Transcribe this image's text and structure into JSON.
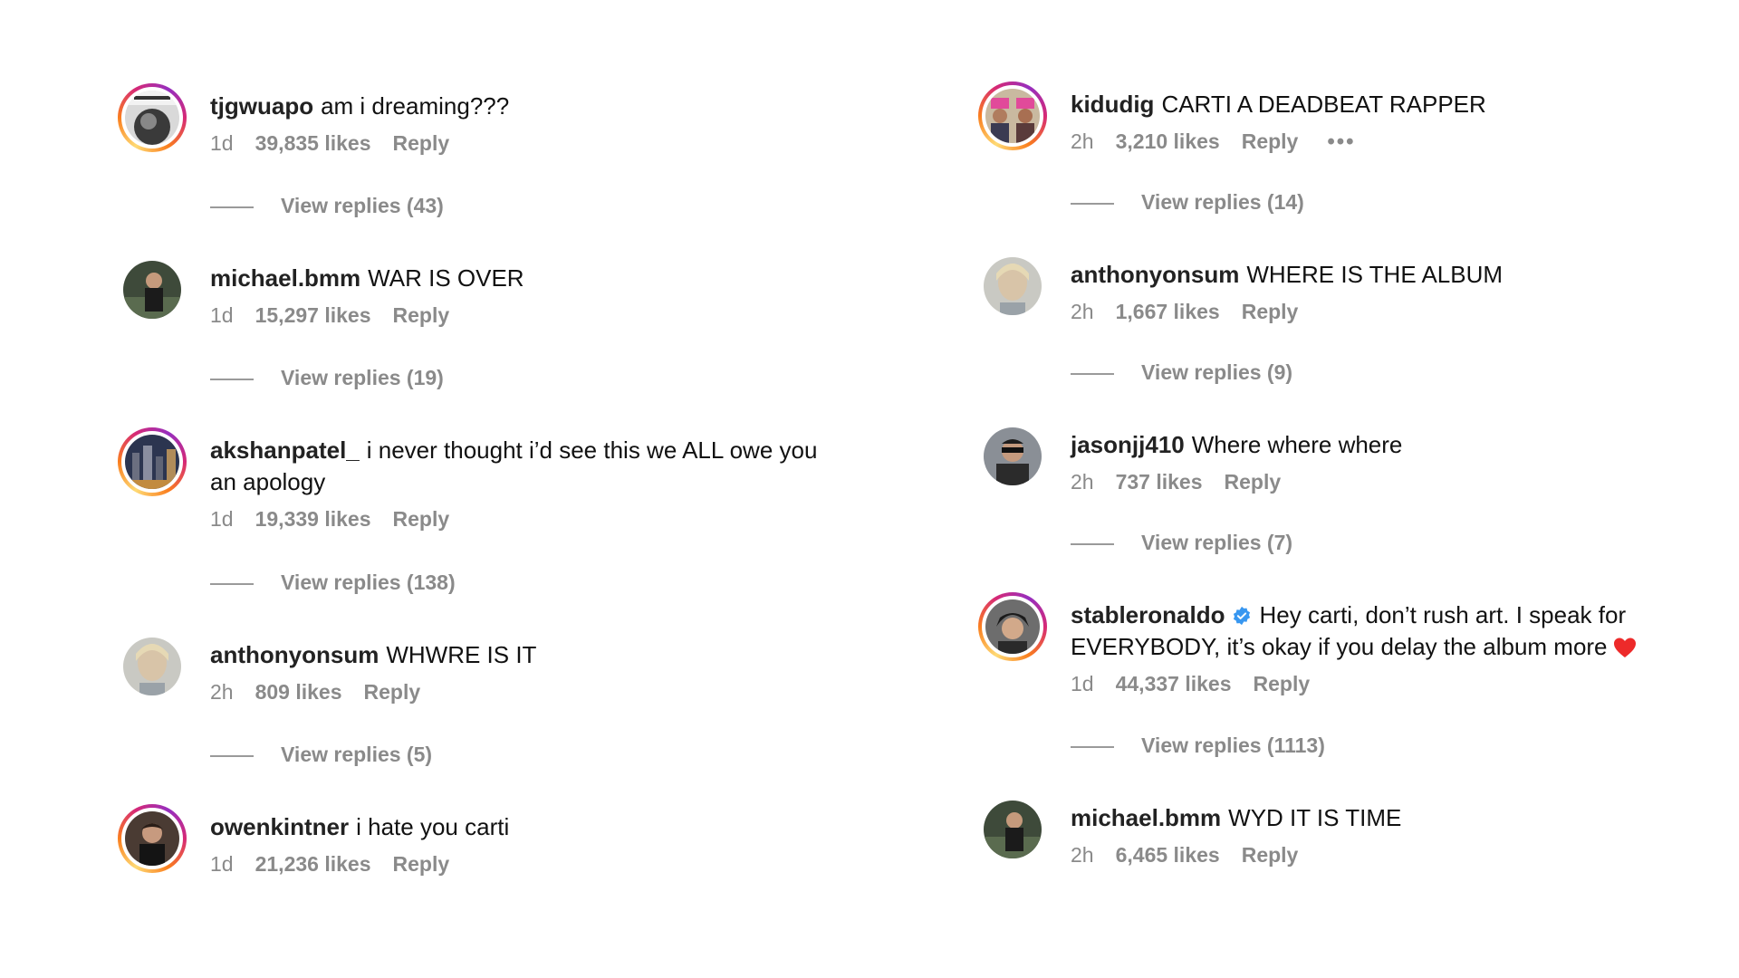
{
  "left_comments": [
    {
      "username": "tjgwuapo",
      "text": "am i dreaming???",
      "time": "1d",
      "likes": "39,835 likes",
      "reply": "Reply",
      "view_replies": "View replies (43)",
      "avatar_icon": "photo-avatar",
      "story_ring": true
    },
    {
      "username": "michael.bmm",
      "text": "WAR IS OVER",
      "time": "1d",
      "likes": "15,297 likes",
      "reply": "Reply",
      "view_replies": "View replies (19)",
      "avatar_icon": "photo-avatar",
      "story_ring": false
    },
    {
      "username": "akshanpatel_",
      "text": "i never thought i’d see this we ALL owe you an apology",
      "time": "1d",
      "likes": "19,339 likes",
      "reply": "Reply",
      "view_replies": "View replies (138)",
      "avatar_icon": "photo-avatar",
      "story_ring": true
    },
    {
      "username": "anthonyonsum",
      "text": "WHWRE IS IT",
      "time": "2h",
      "likes": "809 likes",
      "reply": "Reply",
      "view_replies": "View replies (5)",
      "avatar_icon": "photo-avatar",
      "story_ring": false
    },
    {
      "username": "owenkintner",
      "text": "i hate you carti",
      "time": "1d",
      "likes": "21,236 likes",
      "reply": "Reply",
      "view_replies": "",
      "avatar_icon": "photo-avatar",
      "story_ring": true
    }
  ],
  "right_comments": [
    {
      "username": "kidudig",
      "text": "CARTI A DEADBEAT RAPPER",
      "time": "2h",
      "likes": "3,210 likes",
      "reply": "Reply",
      "more": "•••",
      "view_replies": "View replies (14)",
      "avatar_icon": "photo-avatar",
      "story_ring": true
    },
    {
      "username": "anthonyonsum",
      "text": "WHERE IS THE ALBUM",
      "time": "2h",
      "likes": "1,667 likes",
      "reply": "Reply",
      "view_replies": "View replies (9)",
      "avatar_icon": "photo-avatar",
      "story_ring": false
    },
    {
      "username": "jasonjj410",
      "text": "Where where where",
      "time": "2h",
      "likes": "737 likes",
      "reply": "Reply",
      "view_replies": "View replies (7)",
      "avatar_icon": "photo-avatar",
      "story_ring": false
    },
    {
      "username": "stableronaldo",
      "verified": true,
      "text": "Hey carti, don’t rush art. I speak for EVERYBODY, it’s okay if you delay the album more",
      "heart": "red-heart-emoji",
      "time": "1d",
      "likes": "44,337 likes",
      "reply": "Reply",
      "view_replies": "View replies (1113)",
      "avatar_icon": "photo-avatar",
      "story_ring": true
    },
    {
      "username": "michael.bmm",
      "text": "WYD IT IS TIME",
      "time": "2h",
      "likes": "6,465 likes",
      "reply": "Reply",
      "view_replies": "",
      "avatar_icon": "photo-avatar",
      "story_ring": false
    }
  ],
  "colors": {
    "meta_gray": "#8a8a8a",
    "text": "#111111",
    "verified_blue": "#3897f0",
    "heart_red": "#ed2a2a"
  }
}
